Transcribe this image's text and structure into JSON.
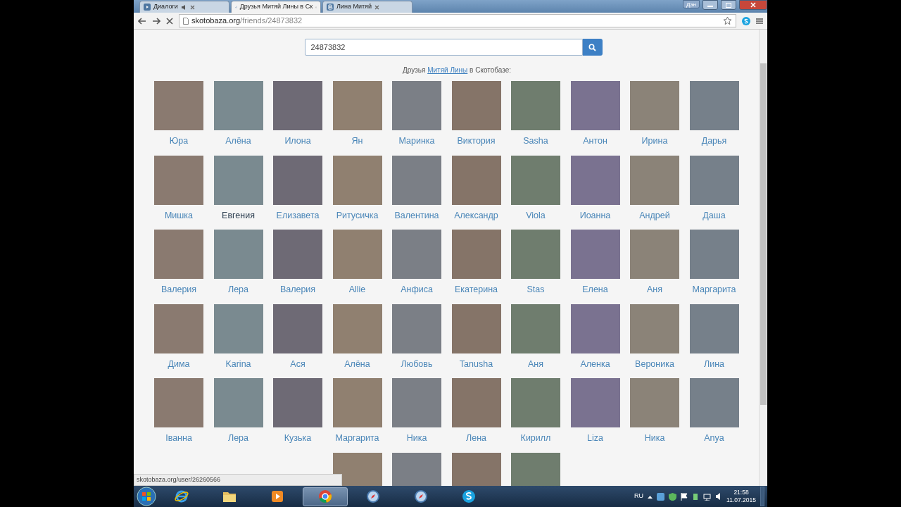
{
  "browser": {
    "tabs": [
      {
        "title": "Диалоги",
        "selected": false,
        "kind": "audio"
      },
      {
        "title": "Друзья Митяй Лины в Ск",
        "selected": true,
        "kind": "loading"
      },
      {
        "title": "Лина Митяй",
        "selected": false,
        "kind": "site"
      }
    ],
    "profile_button": "Дэн",
    "address": {
      "host": "skotobaza.org",
      "path": "/friends/24873832"
    }
  },
  "page": {
    "search": {
      "value": "24873832"
    },
    "caption": {
      "before": "Друзья",
      "link": "Митяй Лины",
      "after": "в Скотобазе:"
    },
    "friends": [
      {
        "kind": "named",
        "name": "Юра",
        "hovered": false
      },
      {
        "kind": "named",
        "name": "Алёна",
        "hovered": false
      },
      {
        "kind": "named",
        "name": "Илона",
        "hovered": false
      },
      {
        "kind": "named",
        "name": "Ян",
        "hovered": false
      },
      {
        "kind": "named",
        "name": "Маринка",
        "hovered": false
      },
      {
        "kind": "named",
        "name": "Виктория",
        "hovered": false
      },
      {
        "kind": "named",
        "name": "Sasha",
        "hovered": false
      },
      {
        "kind": "named",
        "name": "Антон",
        "hovered": false
      },
      {
        "kind": "named",
        "name": "Ирина",
        "hovered": false
      },
      {
        "kind": "named",
        "name": "Дарья",
        "hovered": false
      },
      {
        "kind": "named",
        "name": "Мишка",
        "hovered": false
      },
      {
        "kind": "named",
        "name": "Евгения",
        "hovered": true
      },
      {
        "kind": "named",
        "name": "Елизавета",
        "hovered": false
      },
      {
        "kind": "named",
        "name": "Ритусичка",
        "hovered": false
      },
      {
        "kind": "named",
        "name": "Валентина",
        "hovered": false
      },
      {
        "kind": "named",
        "name": "Александр",
        "hovered": false
      },
      {
        "kind": "named",
        "name": "Viola",
        "hovered": false
      },
      {
        "kind": "named",
        "name": "Иоанна",
        "hovered": false
      },
      {
        "kind": "named",
        "name": "Андрей",
        "hovered": false
      },
      {
        "kind": "named",
        "name": "Даша",
        "hovered": false
      },
      {
        "kind": "named",
        "name": "Валерия",
        "hovered": false
      },
      {
        "kind": "named",
        "name": "Лера",
        "hovered": false
      },
      {
        "kind": "named",
        "name": "Валерия",
        "hovered": false
      },
      {
        "kind": "named",
        "name": "Allie",
        "hovered": false
      },
      {
        "kind": "named",
        "name": "Анфиса",
        "hovered": false
      },
      {
        "kind": "named",
        "name": "Екатерина",
        "hovered": false
      },
      {
        "kind": "named",
        "name": "Stas",
        "hovered": false
      },
      {
        "kind": "named",
        "name": "Елена",
        "hovered": false
      },
      {
        "kind": "named",
        "name": "Аня",
        "hovered": false
      },
      {
        "kind": "named",
        "name": "Маргарита",
        "hovered": false
      },
      {
        "kind": "named",
        "name": "Дима",
        "hovered": false
      },
      {
        "kind": "named",
        "name": "Karina",
        "hovered": false
      },
      {
        "kind": "named",
        "name": "Ася",
        "hovered": false
      },
      {
        "kind": "named",
        "name": "Алёна",
        "hovered": false
      },
      {
        "kind": "named",
        "name": "Любовь",
        "hovered": false
      },
      {
        "kind": "named",
        "name": "Tanusha",
        "hovered": false
      },
      {
        "kind": "named",
        "name": "Аня",
        "hovered": false
      },
      {
        "kind": "named",
        "name": "Аленка",
        "hovered": false
      },
      {
        "kind": "named",
        "name": "Вероника",
        "hovered": false
      },
      {
        "kind": "named",
        "name": "Лина",
        "hovered": false
      },
      {
        "kind": "named",
        "name": "Іванна",
        "hovered": false
      },
      {
        "kind": "named",
        "name": "Лера",
        "hovered": false
      },
      {
        "kind": "named",
        "name": "Кузька",
        "hovered": false
      },
      {
        "kind": "named",
        "name": "Маргарита",
        "hovered": false
      },
      {
        "kind": "named",
        "name": "Ника",
        "hovered": false
      },
      {
        "kind": "named",
        "name": "Лена",
        "hovered": false
      },
      {
        "kind": "named",
        "name": "Кирилл",
        "hovered": false
      },
      {
        "kind": "named",
        "name": "Liza",
        "hovered": false
      },
      {
        "kind": "named",
        "name": "Ника",
        "hovered": false
      },
      {
        "kind": "named",
        "name": "Anya",
        "hovered": false
      },
      {
        "kind": "spacer"
      },
      {
        "kind": "spacer"
      },
      {
        "kind": "spacer"
      },
      {
        "kind": "cut"
      },
      {
        "kind": "cut"
      },
      {
        "kind": "cut"
      },
      {
        "kind": "cut"
      }
    ],
    "status_url": "skotobaza.org/user/26260566"
  },
  "taskbar": {
    "apps": [
      {
        "kind": "ie",
        "selected": false
      },
      {
        "kind": "folder",
        "selected": false
      },
      {
        "kind": "player",
        "selected": false
      },
      {
        "kind": "chrome",
        "selected": true
      },
      {
        "kind": "compass",
        "selected": false
      },
      {
        "kind": "compass",
        "selected": false
      },
      {
        "kind": "skype",
        "selected": false
      }
    ],
    "language": "RU",
    "time": "21:58",
    "date": "11.07.2015"
  }
}
